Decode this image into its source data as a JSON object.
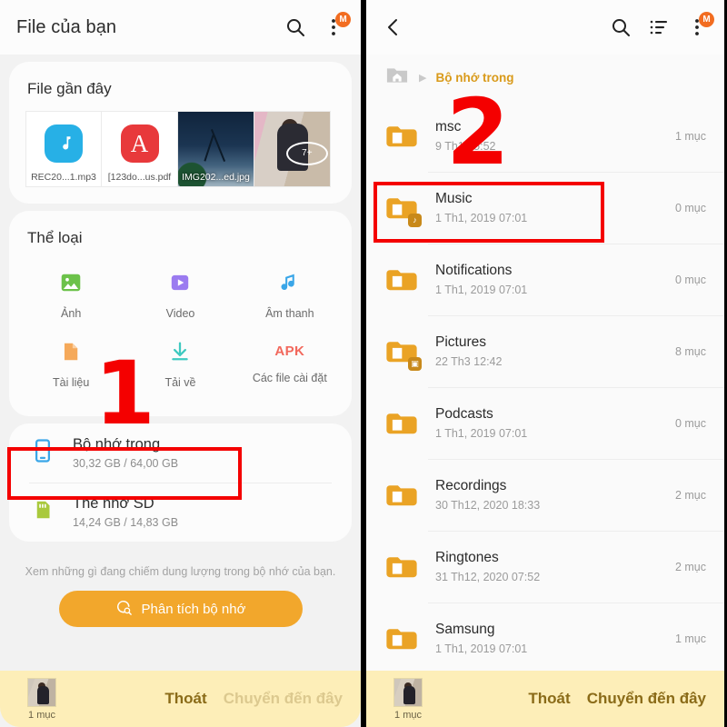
{
  "left": {
    "appbar": {
      "title": "File của bạn",
      "search_icon": "search-icon",
      "menu_icon": "overflow-menu-icon",
      "badge": "M"
    },
    "recent": {
      "title": "File gần đây",
      "items": [
        {
          "label": "REC20...1.mp3",
          "kind": "mp3"
        },
        {
          "label": "[123do...us.pdf",
          "kind": "pdf"
        },
        {
          "label": "IMG202...ed.jpg",
          "kind": "photo-a"
        },
        {
          "label": "",
          "kind": "photo-b",
          "overlay": "7+"
        }
      ]
    },
    "categories": {
      "title": "Thể loại",
      "items": [
        {
          "label": "Ảnh",
          "icon": "image-icon",
          "color": "#6cc24a"
        },
        {
          "label": "Video",
          "icon": "video-play-icon",
          "color": "#9b7bf0"
        },
        {
          "label": "Âm thanh",
          "icon": "music-note-icon",
          "color": "#3aa6e8"
        },
        {
          "label": "Tài liệu",
          "icon": "document-icon",
          "color": "#f5a košик"
        },
        {
          "label": "Tải về",
          "icon": "download-icon",
          "color": "#3fc9c0"
        },
        {
          "label": "Các file cài đặt",
          "icon": "apk-icon",
          "color": "#f2685c"
        }
      ]
    },
    "storage": [
      {
        "name": "Bộ nhớ trong",
        "sub": "30,32 GB / 64,00 GB",
        "icon": "phone-icon"
      },
      {
        "name": "Thẻ nhớ SD",
        "sub": "14,24 GB / 14,83 GB",
        "icon": "sd-card-icon"
      }
    ],
    "hint": "Xem những gì đang chiếm dung lượng trong bộ nhớ của bạn.",
    "analyze_button": "Phân tích bộ nhớ",
    "bottombar": {
      "count": "1 mục",
      "exit": "Thoát",
      "move_here": "Chuyển đến đây"
    }
  },
  "right": {
    "appbar": {
      "back_icon": "back-arrow-icon",
      "search_icon": "search-icon",
      "sort_icon": "sort-list-icon",
      "menu_icon": "overflow-menu-icon",
      "badge": "M"
    },
    "breadcrumb": {
      "home_icon": "home-folder-icon",
      "separator": "▶",
      "path": "Bộ nhớ trong"
    },
    "rows": [
      {
        "name": "msc",
        "date": "9 Th1 15:52",
        "count": "1 mục",
        "badge": ""
      },
      {
        "name": "Music",
        "date": "1 Th1, 2019 07:01",
        "count": "0 mục",
        "badge": "♪"
      },
      {
        "name": "Notifications",
        "date": "1 Th1, 2019 07:01",
        "count": "0 mục",
        "badge": ""
      },
      {
        "name": "Pictures",
        "date": "22 Th3 12:42",
        "count": "8 mục",
        "badge": "▣"
      },
      {
        "name": "Podcasts",
        "date": "1 Th1, 2019 07:01",
        "count": "0 mục",
        "badge": ""
      },
      {
        "name": "Recordings",
        "date": "30 Th12, 2020 18:33",
        "count": "2 mục",
        "badge": ""
      },
      {
        "name": "Ringtones",
        "date": "31 Th12, 2020 07:52",
        "count": "2 mục",
        "badge": ""
      },
      {
        "name": "Samsung",
        "date": "1 Th1, 2019 07:01",
        "count": "1 mục",
        "badge": ""
      }
    ],
    "bottombar": {
      "count": "1 mục",
      "exit": "Thoát",
      "move_here": "Chuyển đến đây"
    }
  },
  "annotations": {
    "step1": "1",
    "step2": "2",
    "color": "#f40000"
  }
}
